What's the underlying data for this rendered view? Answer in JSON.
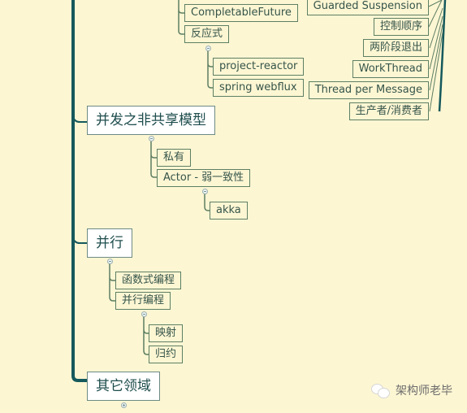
{
  "colors": {
    "background": "#fdf6d3",
    "trunk": "#15595c",
    "branch_line": "#5d7f63",
    "node_border": "#5d7f63",
    "node_text": "#35554a",
    "main_text": "#1f4d4d",
    "main_fill": "#ffffff"
  },
  "left_tree": {
    "async_branch": {
      "children": [
        {
          "label": "CompletableFuture"
        },
        {
          "label": "反应式",
          "children": [
            {
              "label": "project-reactor"
            },
            {
              "label": "spring webflux"
            }
          ]
        }
      ]
    },
    "topics": [
      {
        "label": "并发之非共享模型",
        "children": [
          {
            "label": "私有"
          },
          {
            "label": "Actor - 弱一致性",
            "children": [
              {
                "label": "akka"
              }
            ]
          }
        ]
      },
      {
        "label": "并行",
        "children": [
          {
            "label": "函数式编程"
          },
          {
            "label": "并行编程",
            "children": [
              {
                "label": "映射"
              },
              {
                "label": "归约"
              }
            ]
          }
        ]
      },
      {
        "label": "其它领域",
        "collapsed": true
      }
    ]
  },
  "right_tree": {
    "children": [
      {
        "label": "Guarded Suspension"
      },
      {
        "label": "控制顺序"
      },
      {
        "label": "两阶段退出"
      },
      {
        "label": "WorkThread"
      },
      {
        "label": "Thread per Message"
      },
      {
        "label": "生产者/消费者"
      }
    ]
  },
  "watermark": {
    "icon": "wechat-icon",
    "text": "架构师老毕"
  }
}
